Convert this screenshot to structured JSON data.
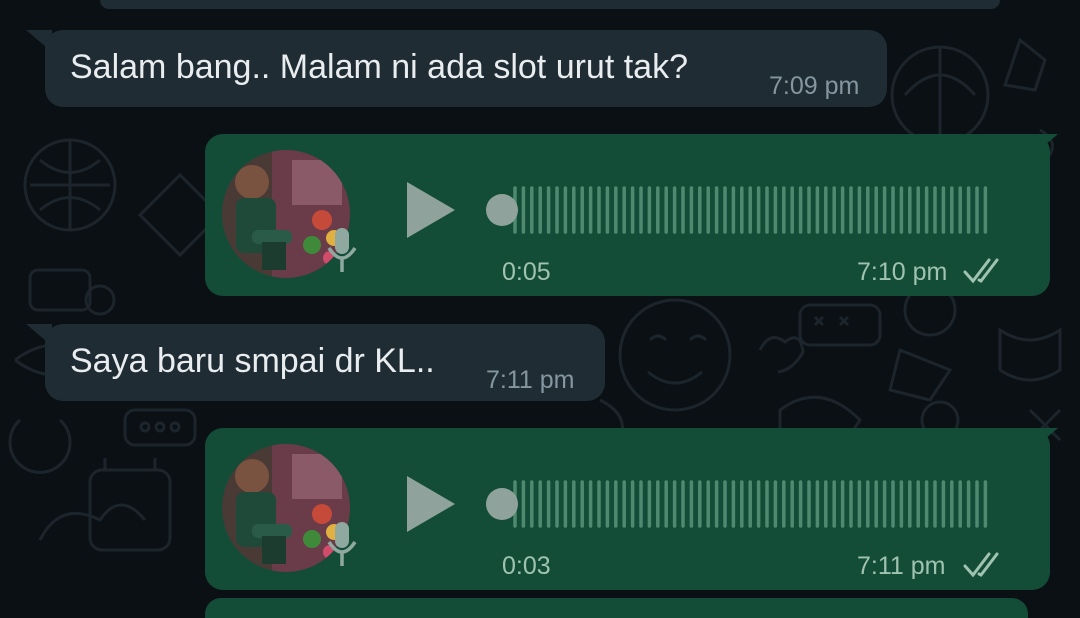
{
  "colors": {
    "background": "#0b1014",
    "incoming_bubble": "#1f2c33",
    "outgoing_bubble": "#144d37",
    "read_ticks": "#9fc3b0"
  },
  "messages": [
    {
      "type": "text",
      "direction": "incoming",
      "text": "Salam bang.. Malam ni ada slot urut tak?",
      "time": "7:09 pm"
    },
    {
      "type": "voice",
      "direction": "outgoing",
      "duration": "0:05",
      "time": "7:10 pm",
      "status": "read",
      "progress": 0
    },
    {
      "type": "text",
      "direction": "incoming",
      "text": "Saya baru smpai dr KL..",
      "time": "7:11 pm"
    },
    {
      "type": "voice",
      "direction": "outgoing",
      "duration": "0:03",
      "time": "7:11 pm",
      "status": "read",
      "progress": 0
    }
  ],
  "icons": {
    "play": "play-icon",
    "mic": "microphone-icon",
    "ticks": "double-check-icon"
  }
}
